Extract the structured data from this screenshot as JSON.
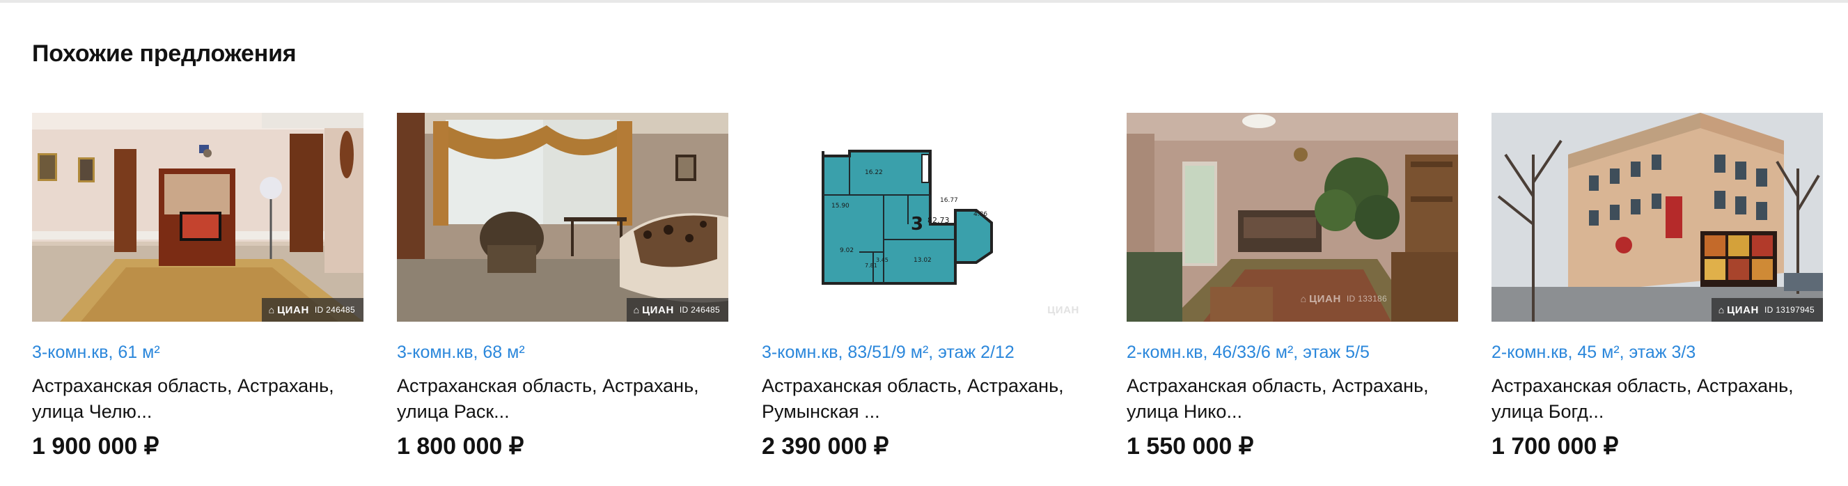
{
  "section": {
    "title": "Похожие предложения"
  },
  "watermark": {
    "brand": "ЦИАН",
    "id_prefix": "ID"
  },
  "colors": {
    "link": "#2b87db",
    "text": "#121212",
    "floorplan": "#3aa0ab"
  },
  "offers": [
    {
      "title": "3-комн.кв, 61 м²",
      "address": "Астраханская область, Астрахань, улица Челю...",
      "price": "1 900 000 ₽",
      "photo_kind": "living-room-photo",
      "photo_id": "ID 246485"
    },
    {
      "title": "3-комн.кв, 68 м²",
      "address": "Астраханская область, Астрахань, улица Раск...",
      "price": "1 800 000 ₽",
      "photo_kind": "bedroom-photo",
      "photo_id": "ID 246485"
    },
    {
      "title": "3-комн.кв, 83/51/9 м², этаж 2/12",
      "address": "Астраханская область, Астрахань, Румынская ...",
      "price": "2 390 000 ₽",
      "photo_kind": "floor-plan",
      "plan": {
        "rooms_label": "3",
        "total": "82.73",
        "areas": [
          "16.22",
          "15.90",
          "16.77",
          "4.86",
          "9.02",
          "13.02",
          "7.81",
          "3.45"
        ]
      }
    },
    {
      "title": "2-комн.кв, 46/33/6 м², этаж 5/5",
      "address": "Астраханская область, Астрахань, улица Нико...",
      "price": "1 550 000 ₽",
      "photo_kind": "living-room-photo-2",
      "photo_id": "ID 133186"
    },
    {
      "title": "2-комн.кв, 45 м², этаж 3/3",
      "address": "Астраханская область, Астрахань, улица Богд...",
      "price": "1 700 000 ₽",
      "photo_kind": "building-exterior-photo",
      "photo_id": "ID 13197945"
    }
  ]
}
